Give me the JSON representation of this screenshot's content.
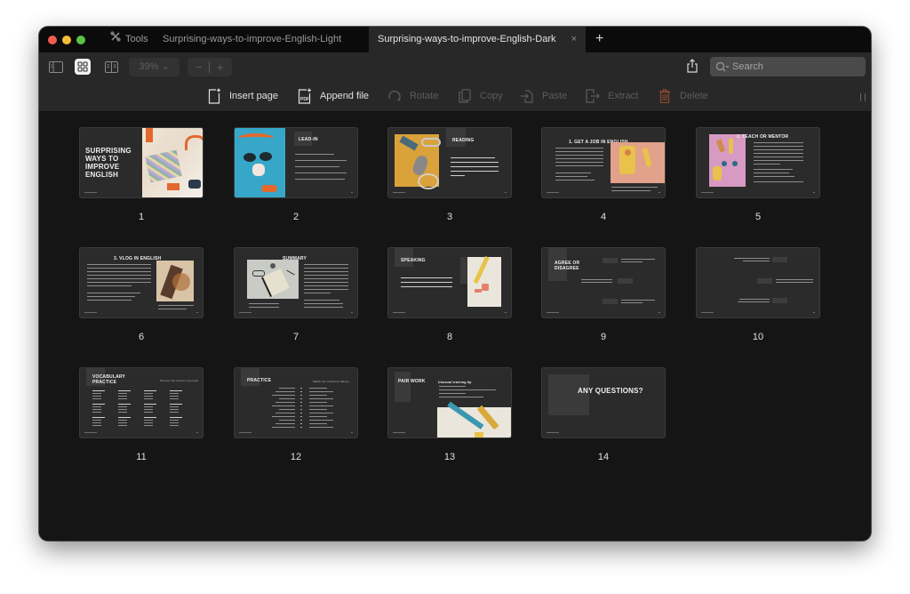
{
  "window": {
    "tabs": [
      {
        "label": "Tools",
        "icon": "tools-icon",
        "active": false
      },
      {
        "label": "Surprising-ways-to-improve-English-Light",
        "active": false
      },
      {
        "label": "Surprising-ways-to-improve-English-Dark",
        "active": true,
        "close_icon": "×"
      }
    ],
    "new_tab_icon": "+"
  },
  "toolbar": {
    "view_modes": [
      "sidebar-view",
      "grid-view",
      "two-page-view"
    ],
    "active_view": "grid-view",
    "zoom_level": "39%",
    "zoom_minus": "−",
    "zoom_plus": "+",
    "search_placeholder": "Search"
  },
  "actions": [
    {
      "label": "Insert page",
      "enabled": true
    },
    {
      "label": "Append file",
      "enabled": true
    },
    {
      "label": "Rotate",
      "enabled": false
    },
    {
      "label": "Copy",
      "enabled": false
    },
    {
      "label": "Paste",
      "enabled": false
    },
    {
      "label": "Extract",
      "enabled": false
    },
    {
      "label": "Delete",
      "enabled": false
    }
  ],
  "colors": {
    "delete_icon": "#8a4a32",
    "accent_orange": "#e4682e"
  },
  "pages": [
    {
      "number": "1",
      "title": "SURPRISING WAYS TO IMPROVE ENGLISH"
    },
    {
      "number": "2",
      "title": "LEAD-IN"
    },
    {
      "number": "3",
      "title": "READING",
      "body": "You'll read 5 unusual tips about improving English. Take turns with your classmate or teacher. Focus on new words, and answer questions after each part."
    },
    {
      "number": "4",
      "title": "1. GET A JOB IN ENGLISH"
    },
    {
      "number": "5",
      "title": "2. TEACH OR MENTOR"
    },
    {
      "number": "6",
      "title": "3. VLOG IN ENGLISH"
    },
    {
      "number": "7",
      "title": "SUMMARY"
    },
    {
      "number": "8",
      "title": "SPEAKING",
      "body": "When was the last time you stepped out of your comfort zone? What did you learn from that experience?"
    },
    {
      "number": "9",
      "title": "AGREE OR DISAGREE"
    },
    {
      "number": "10",
      "title": ""
    },
    {
      "number": "11",
      "title": "VOCABULARY PRACTICE",
      "subtitle": "Choose the correct synonym"
    },
    {
      "number": "12",
      "title": "PRACTICE",
      "subtitle": "Match the sentence halves"
    },
    {
      "number": "13",
      "title": "PAIR WORK",
      "subtitle": "Unusual learning tip"
    },
    {
      "number": "14",
      "title": "ANY QUESTIONS?"
    }
  ]
}
